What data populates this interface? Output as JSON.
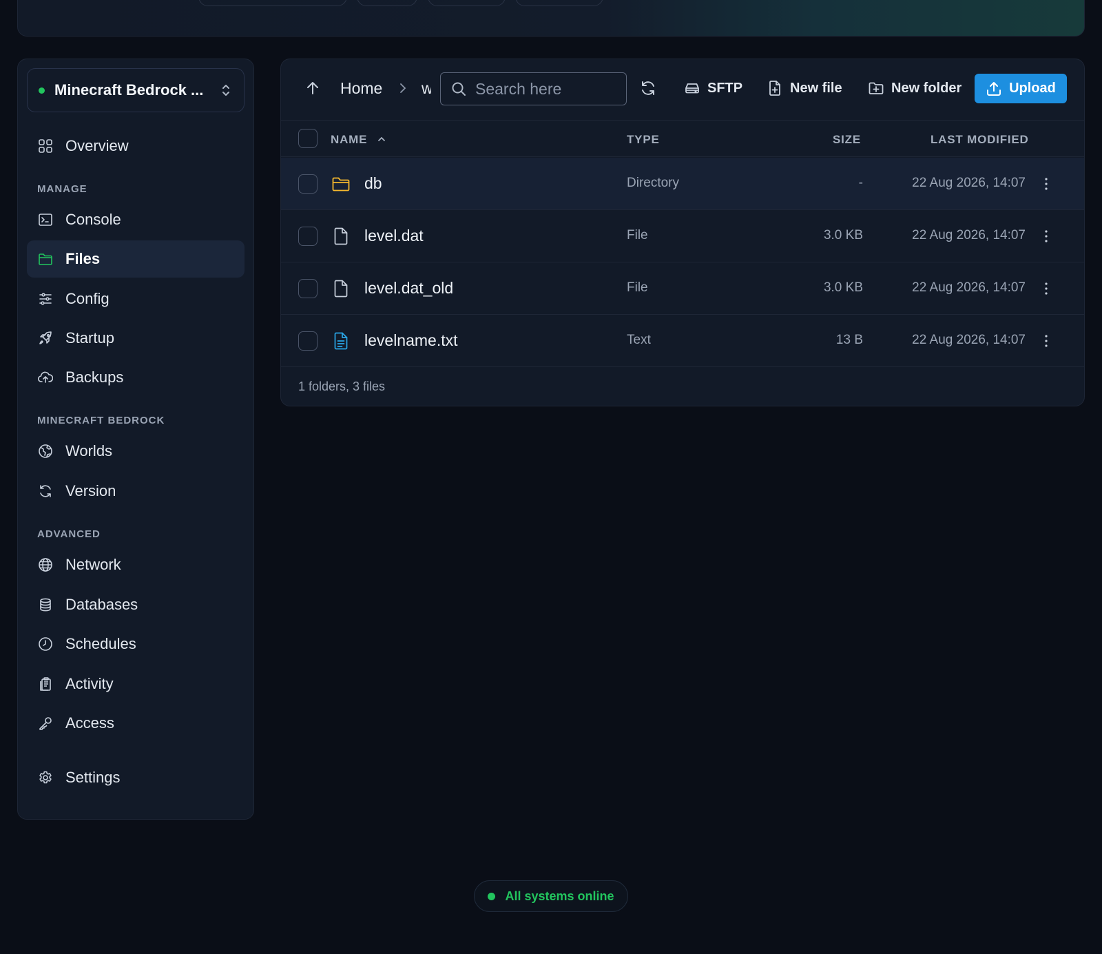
{
  "sidebar": {
    "server_name": "Minecraft Bedrock ...",
    "items": {
      "overview": "Overview",
      "console": "Console",
      "files": "Files",
      "config": "Config",
      "startup": "Startup",
      "backups": "Backups",
      "worlds": "Worlds",
      "version": "Version",
      "network": "Network",
      "databases": "Databases",
      "schedules": "Schedules",
      "activity": "Activity",
      "access": "Access",
      "settings": "Settings"
    },
    "sections": {
      "manage": "MANAGE",
      "game": "MINECRAFT BEDROCK",
      "advanced": "ADVANCED"
    },
    "active_item": "Files"
  },
  "toolbar": {
    "breadcrumb_home": "Home",
    "breadcrumb_current": "w",
    "search_placeholder": "Search here",
    "sftp_label": "SFTP",
    "new_file_label": "New file",
    "new_folder_label": "New folder",
    "upload_label": "Upload"
  },
  "table": {
    "headers": {
      "name": "NAME",
      "type": "TYPE",
      "size": "SIZE",
      "modified": "LAST MODIFIED"
    },
    "rows": [
      {
        "name": "db",
        "type": "Directory",
        "size": "-",
        "modified": "22 Aug 2026, 14:07",
        "icon": "folder-icon"
      },
      {
        "name": "level.dat",
        "type": "File",
        "size": "3.0 KB",
        "modified": "22 Aug 2026, 14:07",
        "icon": "file-icon"
      },
      {
        "name": "level.dat_old",
        "type": "File",
        "size": "3.0 KB",
        "modified": "22 Aug 2026, 14:07",
        "icon": "file-icon"
      },
      {
        "name": "levelname.txt",
        "type": "Text",
        "size": "13 B",
        "modified": "22 Aug 2026, 14:07",
        "icon": "text-file-icon"
      }
    ],
    "summary": "1 folders, 3 files"
  },
  "status": {
    "label": "All systems online"
  },
  "colors": {
    "accent": "#1d8fe0",
    "online": "#22c55e",
    "folder": "#f5b82e",
    "text_file": "#2aa7e8"
  }
}
